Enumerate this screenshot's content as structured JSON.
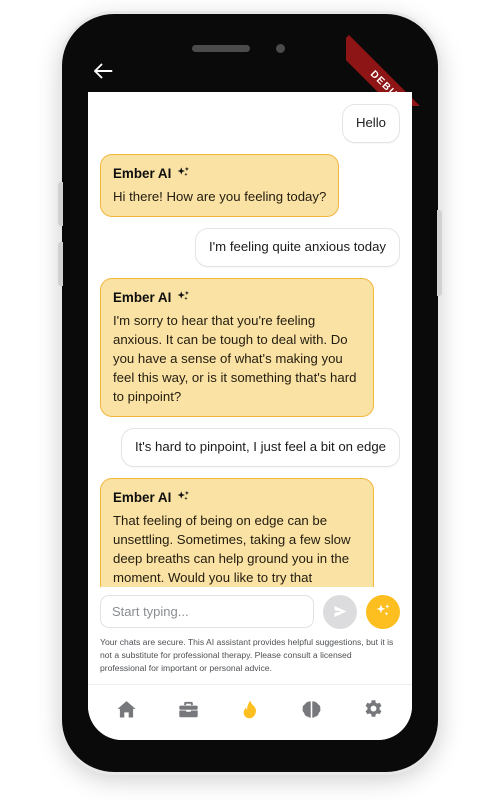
{
  "device": {
    "debug_ribbon_label": "DEBUG",
    "back_icon": "back-arrow-icon",
    "speaker_icon": "speaker-grille",
    "camera_icon": "front-camera"
  },
  "colors": {
    "ai_bubble_bg": "#FAE2A4",
    "ai_bubble_border": "#F0B73D",
    "user_bubble_bg": "#FFFFFF",
    "user_bubble_border": "#E4E4E6",
    "accent": "#FDBE20",
    "send_button_bg": "#DCDCDE",
    "ribbon": "#8E1515",
    "nav_inactive": "#77787B",
    "nav_active": "#FDBE20"
  },
  "chat": {
    "assistant_name": "Ember AI",
    "messages": [
      {
        "role": "user",
        "text": "Hello"
      },
      {
        "role": "assistant",
        "sender": "Ember AI",
        "text": "Hi there! How are you feeling today?"
      },
      {
        "role": "user",
        "text": "I'm feeling quite anxious today"
      },
      {
        "role": "assistant",
        "sender": "Ember AI",
        "text": "I'm sorry to hear that you're feeling anxious. It can be tough to deal with. Do you have a sense of what's making you feel this way, or is it something that's hard to pinpoint?"
      },
      {
        "role": "user",
        "text": "It's hard to pinpoint, I just feel a bit on edge"
      },
      {
        "role": "assistant",
        "sender": "Ember AI",
        "text": "That feeling of being on edge can be unsettling. Sometimes, taking a few slow deep breaths can help ground you in the moment. Would you like to try that together? Just inhale slowly through your nose, hold for a moment, and then exhale gently through your mouth. Let me know how it feels or if there's anything else on your mind."
      }
    ]
  },
  "composer": {
    "placeholder": "Start typing...",
    "input_value": "",
    "send_icon": "send-paper-plane-icon",
    "suggest_icon": "sparkle-icon"
  },
  "disclaimer": {
    "text": "Your chats are secure. This AI assistant provides helpful suggestions, but it is not a substitute for professional therapy. Please consult a licensed professional for important or personal advice."
  },
  "bottom_nav": {
    "items": [
      {
        "name": "home",
        "icon": "home-icon",
        "active": false
      },
      {
        "name": "toolbox",
        "icon": "toolbox-icon",
        "active": false
      },
      {
        "name": "chat",
        "icon": "flame-icon",
        "active": true
      },
      {
        "name": "insights",
        "icon": "brain-icon",
        "active": false
      },
      {
        "name": "settings",
        "icon": "gear-icon",
        "active": false
      }
    ]
  }
}
